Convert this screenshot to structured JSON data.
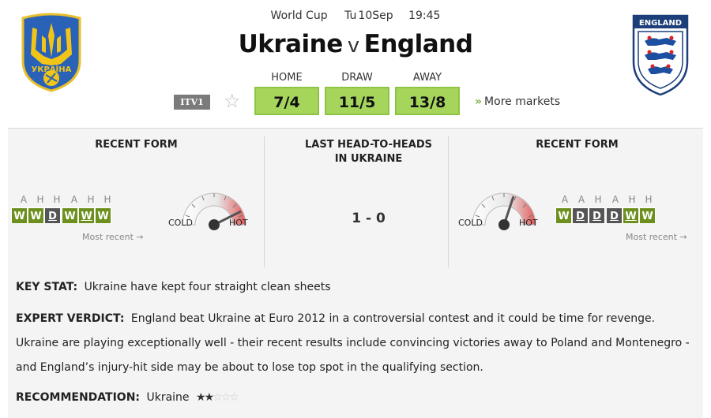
{
  "match": {
    "competition": "World Cup",
    "day": "Tu",
    "date": "10Sep",
    "time": "19:45",
    "home_team": "Ukraine",
    "separator": "v",
    "away_team": "England",
    "home_crest_text": "УКРАЇНА",
    "away_crest_text": "ENGLAND"
  },
  "odds": {
    "home": {
      "label": "HOME",
      "value": "7/4"
    },
    "draw": {
      "label": "DRAW",
      "value": "11/5"
    },
    "away": {
      "label": "AWAY",
      "value": "13/8"
    },
    "broadcaster": "ITV1",
    "more_markets": "More markets",
    "button_color": "#a6d55c"
  },
  "form_home": {
    "title": "RECENT FORM",
    "venues": [
      "A",
      "H",
      "H",
      "A",
      "H",
      "H"
    ],
    "results": [
      "W",
      "W",
      "D",
      "W",
      "W",
      "W"
    ],
    "most_recent": "Most recent",
    "cold": "COLD",
    "hot": "HOT",
    "heat_level": 0.85
  },
  "head_to_head": {
    "title_line1": "LAST HEAD-TO-HEADS",
    "title_line2": "IN UKRAINE",
    "score": "1 - 0"
  },
  "form_away": {
    "title": "RECENT FORM",
    "venues": [
      "A",
      "A",
      "H",
      "A",
      "H",
      "H"
    ],
    "results": [
      "W",
      "D",
      "D",
      "D",
      "W",
      "W"
    ],
    "most_recent": "Most recent",
    "cold": "COLD",
    "hot": "HOT",
    "heat_level": 0.6
  },
  "analysis": {
    "key_stat_label": "KEY STAT:",
    "key_stat": "Ukraine have kept four straight clean sheets",
    "verdict_label": "EXPERT VERDICT:",
    "verdict": "England beat Ukraine at Euro 2012 in a controversial contest and it could be time for revenge. Ukraine are playing exceptionally well - their recent results include convincing victories away to Poland and Montenegro - and England’s injury-hit side may be about to lose top spot in the qualifying section.",
    "recommendation_label": "RECOMMENDATION:",
    "recommendation": "Ukraine",
    "rating": 2,
    "rating_max": 5
  },
  "colors": {
    "win": "#6c8f1e",
    "draw": "#555555",
    "panel_bg": "#f4f4f4",
    "accent_arrow": "#7cb342"
  }
}
